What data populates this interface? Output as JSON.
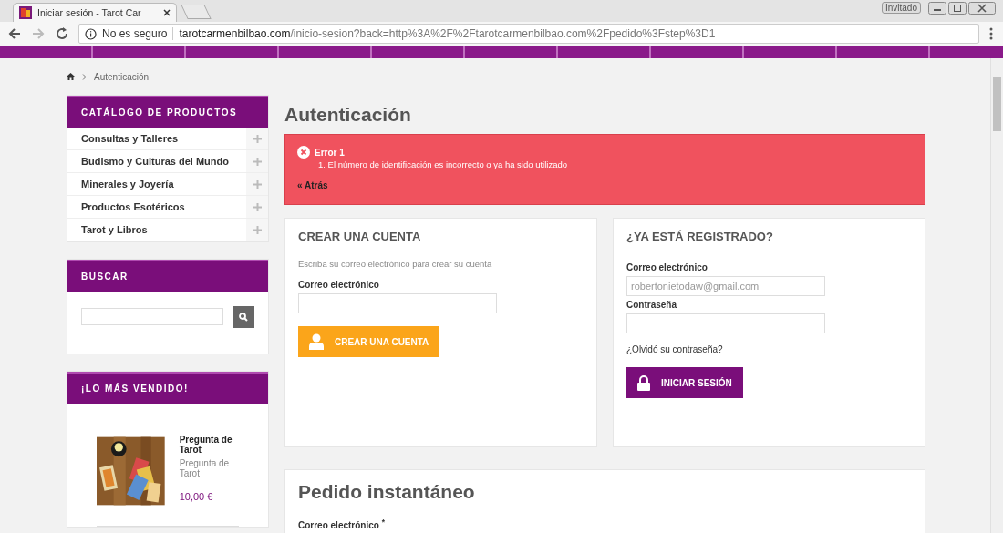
{
  "browser": {
    "tab_title": "Iniciar sesión - Tarot Car",
    "profile": "Invitado",
    "security": "No es seguro",
    "url_host": "tarotcarmenbilbao.com",
    "url_path": "/inicio-sesion?back=http%3A%2F%2Ftarotcarmenbilbao.com%2Fpedido%3Fstep%3D1"
  },
  "breadcrumb": [
    "Autenticación"
  ],
  "sidebar": {
    "catalog": {
      "title": "CATÁLOGO DE PRODUCTOS",
      "items": [
        {
          "label": "Consultas y Talleres"
        },
        {
          "label": "Budismo y Culturas del Mundo"
        },
        {
          "label": "Minerales y Joyería"
        },
        {
          "label": "Productos Esotéricos"
        },
        {
          "label": "Tarot y Libros"
        }
      ]
    },
    "search": {
      "title": "BUSCAR"
    },
    "bestseller": {
      "title": "¡LO MÁS VENDIDO!",
      "product": {
        "kind": "picture",
        "name": "Pregunta de Tarot",
        "description": "Pregunta de Tarot",
        "price": "10,00 €"
      }
    }
  },
  "main": {
    "title": "Autenticación",
    "error": {
      "title": "Error 1",
      "items": [
        {
          "number": "1.",
          "text": "El número de identificación es incorrecto o ya ha sido utilizado"
        }
      ],
      "back_link": "« Atrás"
    },
    "create_account": {
      "title": "CREAR UNA CUENTA",
      "hint": "Escriba su correo electrónico para crear su cuenta",
      "email_label": "Correo electrónico",
      "button": "CREAR UNA CUENTA"
    },
    "login": {
      "title": "¿YA ESTÁ REGISTRADO?",
      "email_label": "Correo electrónico",
      "email_value": "robertonietodaw@gmail.com",
      "password_label": "Contraseña",
      "forgot_link": "¿Olvidó su contraseña?",
      "button": "INICIAR SESIÓN"
    },
    "quick_order": {
      "title": "Pedido instantáneo",
      "email_label": "Correo electrónico $^{*}$"
    }
  }
}
